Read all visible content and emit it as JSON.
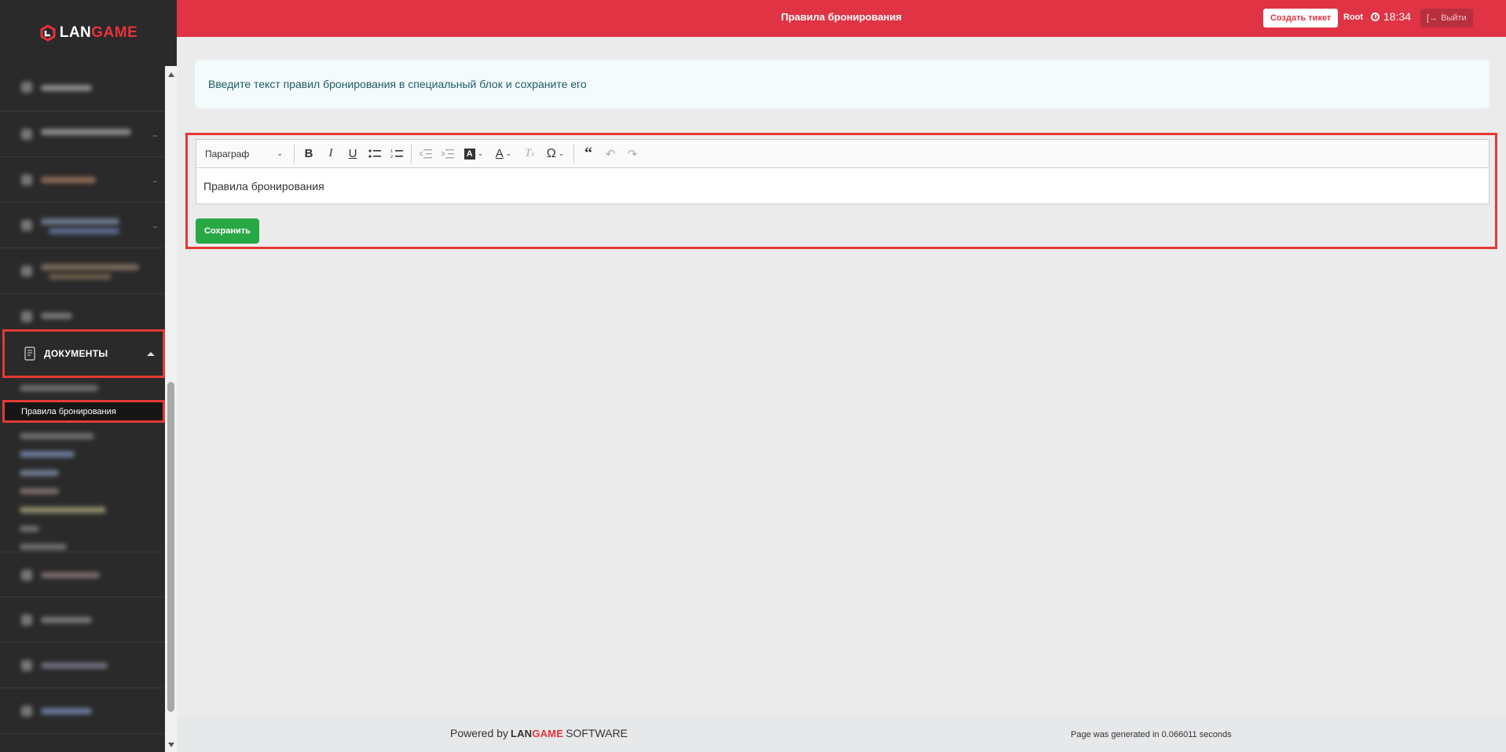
{
  "brand": {
    "logo_part1": "LAN",
    "logo_part2": "GAME"
  },
  "colors": {
    "header_bg": "#e03344",
    "sidebar_bg": "#2a2a2a",
    "highlight_border": "#e53935",
    "save_button": "#28a745",
    "info_text": "#1f5b66"
  },
  "header": {
    "title": "Правила бронирования",
    "create_ticket_label": "Создать тикет",
    "user_name": "Root",
    "time": "18:34",
    "logout_label": "Выйти"
  },
  "sidebar": {
    "section_label": "ДОКУМЕНТЫ",
    "active_subitem": "Правила бронирования"
  },
  "info": {
    "text": "Введите текст правил бронирования в специальный блок и сохраните его"
  },
  "editor": {
    "block_format": "Параграф",
    "content": "Правила бронирования",
    "save_label": "Сохранить"
  },
  "footer": {
    "powered_by": "Powered by",
    "brand_part1": "LAN",
    "brand_part2": "GAME",
    "software": "SOFTWARE",
    "generated_text": "Page was generated in 0.066011 seconds"
  }
}
